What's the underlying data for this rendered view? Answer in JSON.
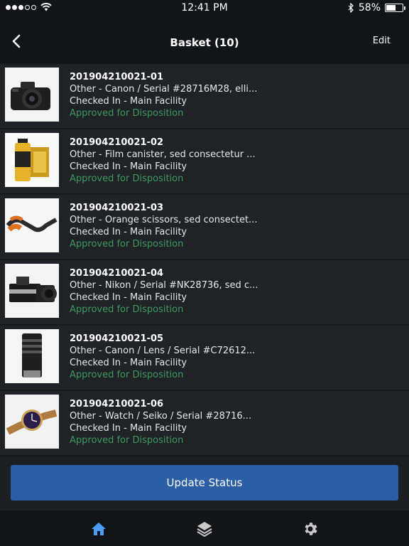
{
  "status_bar": {
    "time": "12:41 PM",
    "battery": "58%",
    "battery_level": 0.58
  },
  "nav": {
    "title": "Basket (10)",
    "edit_label": "Edit",
    "back_icon": "chevron-left-icon"
  },
  "items": [
    {
      "id": "201904210021-01",
      "desc": "Other - Canon / Serial #28716M28, elli...",
      "location": "Checked In - Main Facility",
      "status": "Approved for Disposition",
      "thumb": "camera"
    },
    {
      "id": "201904210021-02",
      "desc": "Other - Film canister, sed consectetur ...",
      "location": "Checked In - Main Facility",
      "status": "Approved for Disposition",
      "thumb": "film"
    },
    {
      "id": "201904210021-03",
      "desc": "Other - Orange scissors, sed consectet...",
      "location": "Checked In - Main Facility",
      "status": "Approved for Disposition",
      "thumb": "scissors"
    },
    {
      "id": "201904210021-04",
      "desc": "Other - Nikon / Serial #NK28736, sed c...",
      "location": "Checked In - Main Facility",
      "status": "Approved for Disposition",
      "thumb": "nikon"
    },
    {
      "id": "201904210021-05",
      "desc": "Other - Canon / Lens / Serial #C72612...",
      "location": "Checked In - Main Facility",
      "status": "Approved for Disposition",
      "thumb": "lens"
    },
    {
      "id": "201904210021-06",
      "desc": "Other - Watch / Seiko / Serial #28716...",
      "location": "Checked In - Main Facility",
      "status": "Approved for Disposition",
      "thumb": "watch"
    }
  ],
  "actions": {
    "update_label": "Update Status"
  },
  "tabs": [
    {
      "icon": "home-icon",
      "active": true
    },
    {
      "icon": "layers-icon",
      "active": false
    },
    {
      "icon": "gear-icon",
      "active": false
    }
  ],
  "colors": {
    "accent": "#2b5ea4",
    "status_green": "#3f9a5c",
    "active_tab": "#4a9ef5"
  }
}
